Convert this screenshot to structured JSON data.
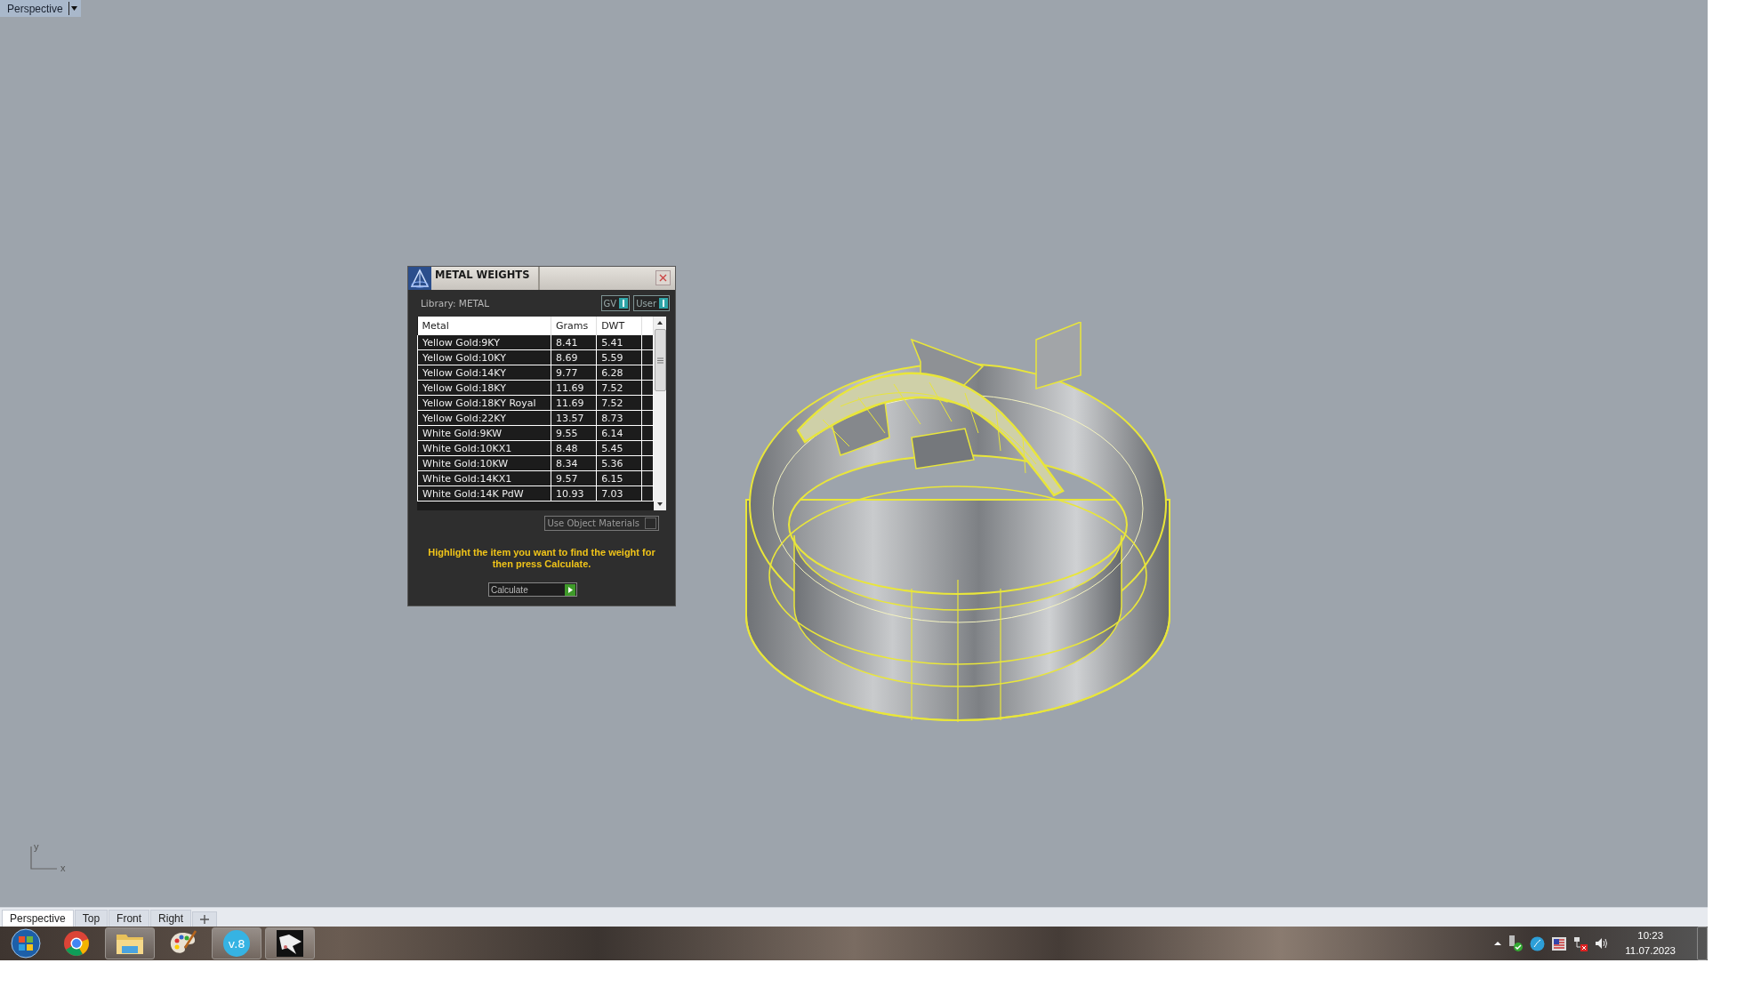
{
  "viewport": {
    "title": "Perspective"
  },
  "dialog": {
    "title": "METAL WEIGHTS",
    "library": "Library: METAL",
    "toggles": [
      {
        "label": "GV",
        "on": true
      },
      {
        "label": "User",
        "on": true
      }
    ],
    "table": {
      "columns": [
        "Metal",
        "Grams",
        "DWT"
      ],
      "rows": [
        [
          "Yellow Gold:9KY",
          "8.41",
          "5.41"
        ],
        [
          "Yellow Gold:10KY",
          "8.69",
          "5.59"
        ],
        [
          "Yellow Gold:14KY",
          "9.77",
          "6.28"
        ],
        [
          "Yellow Gold:18KY",
          "11.69",
          "7.52"
        ],
        [
          "Yellow Gold:18KY Royal",
          "11.69",
          "7.52"
        ],
        [
          "Yellow Gold:22KY",
          "13.57",
          "8.73"
        ],
        [
          "White Gold:9KW",
          "9.55",
          "6.14"
        ],
        [
          "White Gold:10KX1",
          "8.48",
          "5.45"
        ],
        [
          "White Gold:10KW",
          "8.34",
          "5.36"
        ],
        [
          "White Gold:14KX1",
          "9.57",
          "6.15"
        ],
        [
          "White Gold:14K PdW",
          "10.93",
          "7.03"
        ]
      ]
    },
    "use_object_materials": {
      "label": "Use Object Materials",
      "checked": false
    },
    "hint": "Highlight the item you want to find the weight for then press Calculate.",
    "calculate": "Calculate"
  },
  "axis": {
    "x_label": "x",
    "y_label": "y"
  },
  "viewport_tabs": [
    {
      "label": "Perspective",
      "selected": true
    },
    {
      "label": "Top",
      "selected": false
    },
    {
      "label": "Front",
      "selected": false
    },
    {
      "label": "Right",
      "selected": false
    }
  ],
  "taskbar": {
    "apps": [
      {
        "kind": "start",
        "running": false
      },
      {
        "kind": "chrome",
        "running": false
      },
      {
        "kind": "folder",
        "running": true
      },
      {
        "kind": "palette",
        "running": false
      },
      {
        "kind": "v8",
        "running": true,
        "label": "v.8"
      },
      {
        "kind": "cad",
        "running": true
      }
    ],
    "tray": [
      {
        "kind": "arrow"
      },
      {
        "kind": "device"
      },
      {
        "kind": "globe"
      },
      {
        "kind": "flag"
      },
      {
        "kind": "network"
      },
      {
        "kind": "speaker"
      }
    ],
    "clock": {
      "time": "10:23",
      "date": "11.07.2023"
    }
  }
}
